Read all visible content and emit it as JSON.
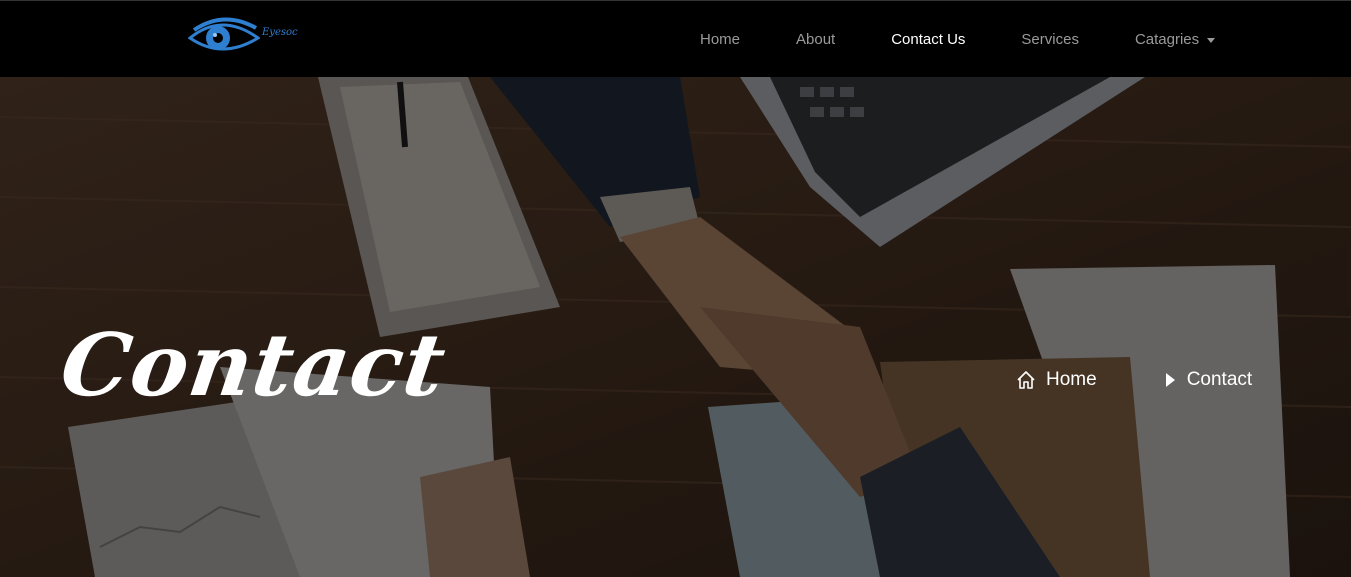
{
  "brand": {
    "logo_text": "Eyesoc"
  },
  "nav": {
    "items": [
      {
        "label": "Home"
      },
      {
        "label": "About"
      },
      {
        "label": "Contact Us"
      },
      {
        "label": "Services"
      },
      {
        "label": "Catagries"
      }
    ]
  },
  "hero": {
    "title": "Contact",
    "breadcrumb": {
      "home": "Home",
      "current": "Contact"
    }
  },
  "colors": {
    "nav_bg": "#000000",
    "nav_text": "#9a9a9a",
    "active": "#ffffff",
    "logo": "#2f7fd0"
  },
  "icons": [
    "eye-logo-icon",
    "home-icon",
    "caret-right-icon",
    "caret-down-icon"
  ]
}
